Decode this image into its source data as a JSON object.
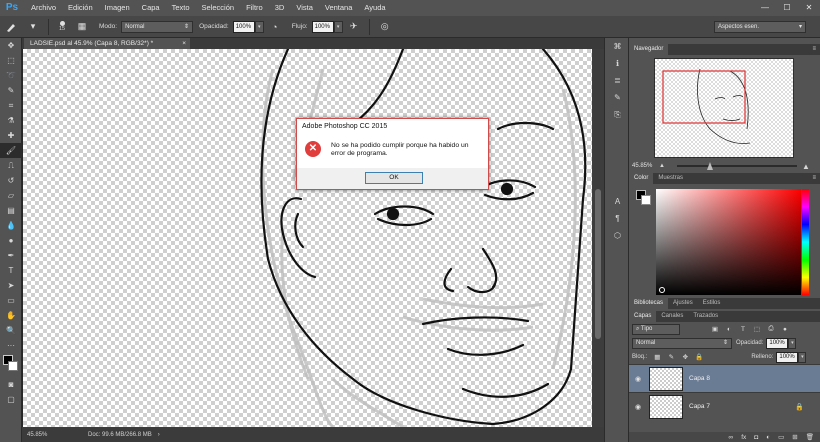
{
  "app": {
    "logo": "Ps"
  },
  "menu": {
    "items": [
      "Archivo",
      "Edición",
      "Imagen",
      "Capa",
      "Texto",
      "Selección",
      "Filtro",
      "3D",
      "Vista",
      "Ventana",
      "Ayuda"
    ]
  },
  "window_controls": {
    "minimize": "—",
    "maximize": "☐",
    "close": "✕"
  },
  "options": {
    "brush_size": "15",
    "mode_label": "Modo:",
    "mode_value": "Normal",
    "opacity_label": "Opacidad:",
    "opacity_value": "100%",
    "flow_label": "Flujo:",
    "flow_value": "100%",
    "workspace": "Aspectos esen."
  },
  "document": {
    "tab_title": "LADSIE.psd al 45.9% (Capa 8, RGB/32*) *",
    "tab_close": "×",
    "status_zoom": "45.85%",
    "status_doc": "Doc: 99.6 MB/266.8 MB"
  },
  "dialog": {
    "title": "Adobe Photoshop CC 2015",
    "message": "No se ha podido cumplir porque ha habido un error de programa.",
    "ok": "OK",
    "icon": "✕"
  },
  "navigator": {
    "tab": "Navegador",
    "zoom": "45.85%",
    "menu": "≡"
  },
  "color": {
    "tab_color": "Color",
    "tab_swatches": "Muestras",
    "menu": "≡",
    "accent": "#ff0000"
  },
  "libraries": {
    "tabs": [
      "Bibliotecas",
      "Ajustes",
      "Estilos"
    ]
  },
  "layers": {
    "tabs": [
      "Capas",
      "Canales",
      "Trazados"
    ],
    "filter_kind": "Tipo",
    "blend_mode": "Normal",
    "opacity_label": "Opacidad:",
    "opacity_value": "100%",
    "lock_label": "Bloq.:",
    "fill_label": "Relleno:",
    "fill_value": "100%",
    "rows": [
      {
        "name": "Capa 8",
        "selected": true
      },
      {
        "name": "Capa 7",
        "selected": false
      }
    ],
    "selection_color": "#6a7b94"
  },
  "footer_icons": [
    "link-icon",
    "fx-icon",
    "mask-icon",
    "adjustment-icon",
    "folder-icon",
    "new-layer-icon",
    "trash-icon"
  ]
}
